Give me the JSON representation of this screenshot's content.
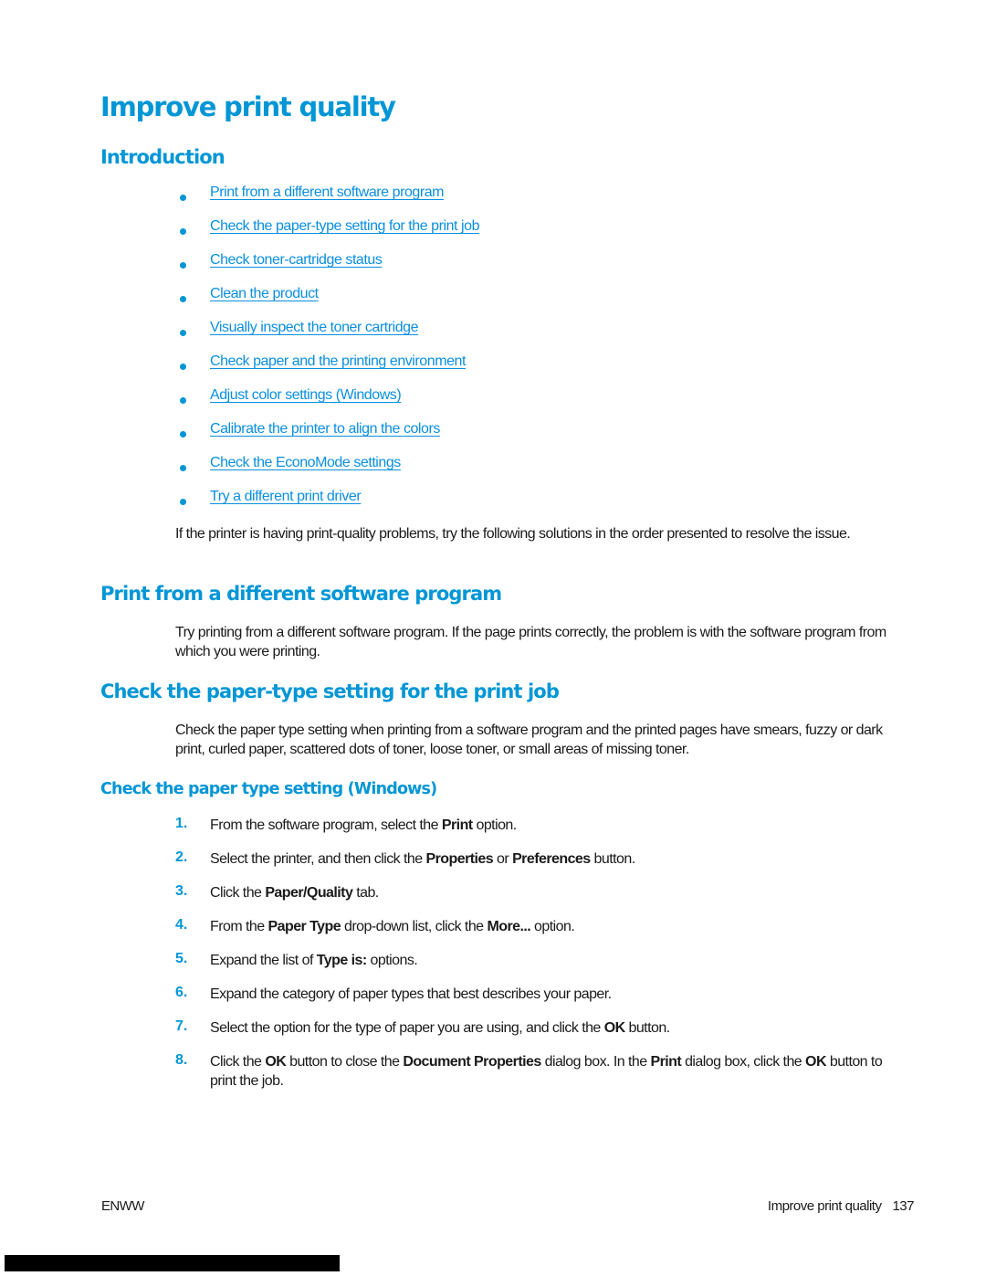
{
  "page": {
    "title": "Improve print quality",
    "introduction": {
      "heading": "Introduction",
      "links": [
        "Print from a different software program",
        "Check the paper-type setting for the print job",
        "Check toner-cartridge status",
        "Clean the product",
        "Visually inspect the toner cartridge",
        "Check paper and the printing environment",
        "Adjust color settings (Windows)",
        "Calibrate the printer to align the colors",
        "Check the EconoMode settings",
        "Try a different print driver"
      ],
      "paragraph": "If the printer is having print-quality problems, try the following solutions in the order presented to resolve the issue."
    },
    "section_software": {
      "heading": "Print from a different software program",
      "paragraph": "Try printing from a different software program. If the page prints correctly, the problem is with the software program from which you were printing."
    },
    "section_paper_type": {
      "heading": "Check the paper-type setting for the print job",
      "paragraph": "Check the paper type setting when printing from a software program and the printed pages have smears, fuzzy or dark print, curled paper, scattered dots of toner, loose toner, or small areas of missing toner.",
      "subsection": {
        "heading": "Check the paper type setting (Windows)",
        "steps": [
          {
            "num": "1.",
            "parts": [
              {
                "t": "From the software program, select the "
              },
              {
                "b": "Print"
              },
              {
                "t": " option."
              }
            ]
          },
          {
            "num": "2.",
            "parts": [
              {
                "t": "Select the printer, and then click the "
              },
              {
                "b": "Properties"
              },
              {
                "t": " or "
              },
              {
                "b": "Preferences"
              },
              {
                "t": " button."
              }
            ]
          },
          {
            "num": "3.",
            "parts": [
              {
                "t": "Click the "
              },
              {
                "b": "Paper/Quality"
              },
              {
                "t": " tab."
              }
            ]
          },
          {
            "num": "4.",
            "parts": [
              {
                "t": "From the "
              },
              {
                "b": "Paper Type"
              },
              {
                "t": " drop-down list, click the "
              },
              {
                "b": "More..."
              },
              {
                "t": " option."
              }
            ]
          },
          {
            "num": "5.",
            "parts": [
              {
                "t": "Expand the list of "
              },
              {
                "b": "Type is:"
              },
              {
                "t": " options."
              }
            ]
          },
          {
            "num": "6.",
            "parts": [
              {
                "t": "Expand the category of paper types that best describes your paper."
              }
            ]
          },
          {
            "num": "7.",
            "parts": [
              {
                "t": "Select the option for the type of paper you are using, and click the "
              },
              {
                "b": "OK"
              },
              {
                "t": " button."
              }
            ]
          },
          {
            "num": "8.",
            "parts": [
              {
                "t": "Click the "
              },
              {
                "b": "OK"
              },
              {
                "t": " button to close the "
              },
              {
                "b": "Document Properties"
              },
              {
                "t": " dialog box. In the "
              },
              {
                "b": "Print"
              },
              {
                "t": " dialog box, click the "
              },
              {
                "b": "OK"
              },
              {
                "t": " button to print the job."
              }
            ]
          }
        ]
      }
    },
    "footer": {
      "left": "ENWW",
      "right_title": "Improve print quality",
      "page_number": "137"
    }
  },
  "colors": {
    "heading": "#0096d6",
    "link": "#0b8fe0",
    "text": "#1a1a1a"
  }
}
